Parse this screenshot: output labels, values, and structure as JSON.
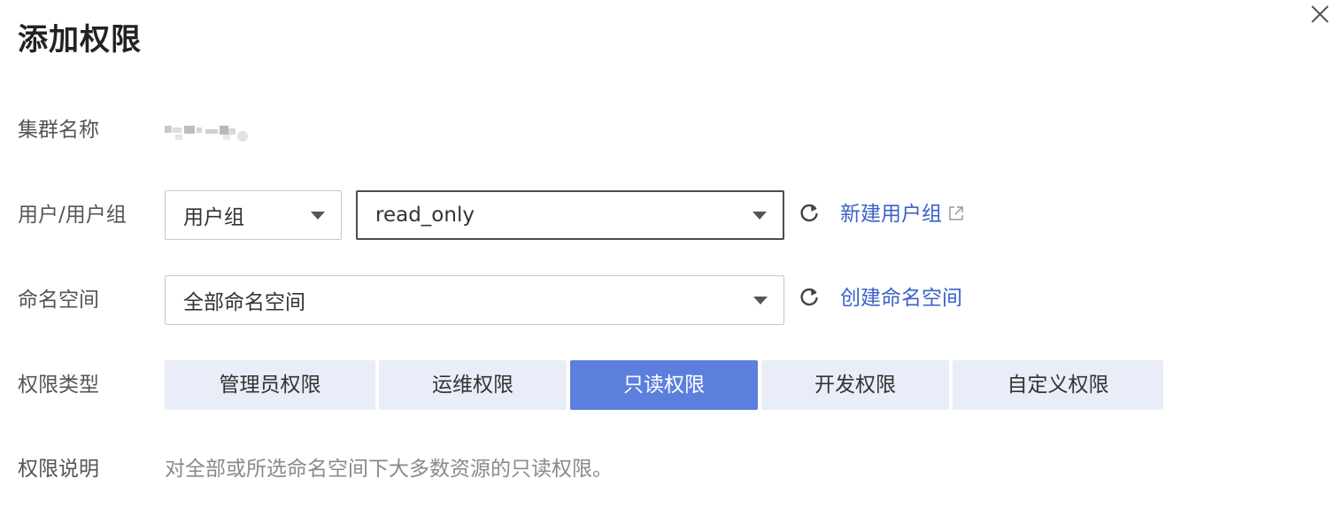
{
  "dialog": {
    "title": "添加权限"
  },
  "form": {
    "cluster": {
      "label": "集群名称"
    },
    "user": {
      "label": "用户/用户组",
      "type_select": "用户组",
      "value_select": "read_only",
      "new_link": "新建用户组"
    },
    "namespace": {
      "label": "命名空间",
      "value_select": "全部命名空间",
      "create_link": "创建命名空间"
    },
    "permission_type": {
      "label": "权限类型",
      "options": [
        "管理员权限",
        "运维权限",
        "只读权限",
        "开发权限",
        "自定义权限"
      ],
      "selected": "只读权限"
    },
    "permission_desc": {
      "label": "权限说明",
      "text": "对全部或所选命名空间下大多数资源的只读权限。"
    }
  },
  "colors": {
    "accent": "#5c7fde",
    "link": "#3b62c9",
    "segment_bg": "#e8edf7"
  },
  "icons": {
    "close": "close-icon",
    "refresh": "refresh-icon",
    "external": "external-link-icon",
    "dropdown": "caret-down-icon"
  }
}
